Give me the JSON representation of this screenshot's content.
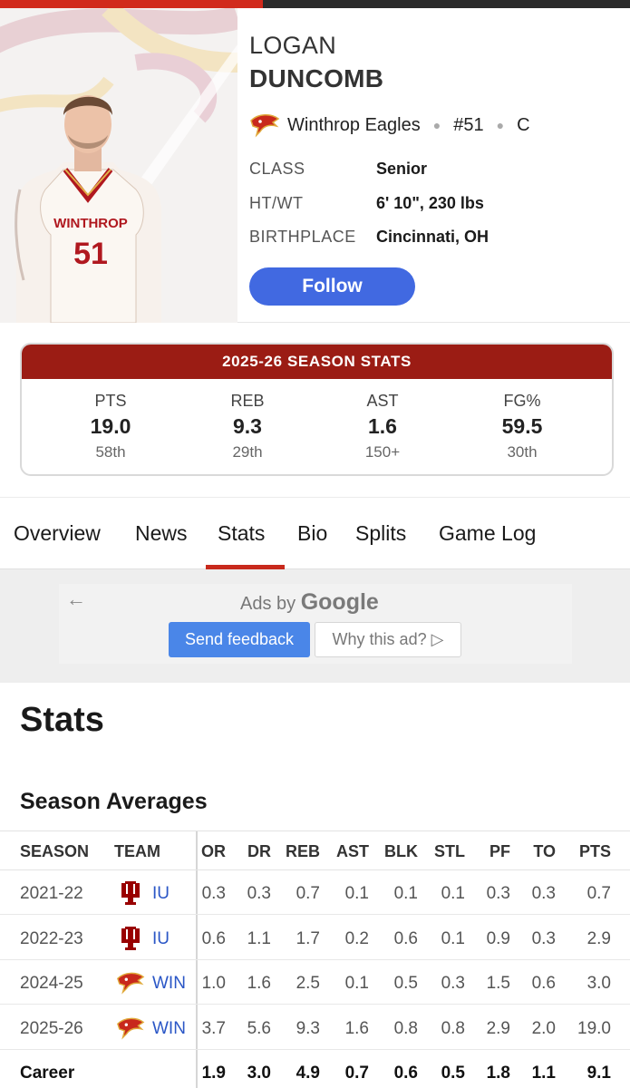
{
  "player": {
    "first_name": "LOGAN",
    "last_name": "DUNCOMB",
    "team": "Winthrop Eagles",
    "number": "#51",
    "position": "C",
    "jersey_text": "WINTHROP",
    "jersey_number": "51"
  },
  "bio": [
    {
      "label": "CLASS",
      "value": "Senior"
    },
    {
      "label": "HT/WT",
      "value": "6' 10\", 230 lbs"
    },
    {
      "label": "BIRTHPLACE",
      "value": "Cincinnati, OH"
    }
  ],
  "follow_label": "Follow",
  "season_card": {
    "title": "2025-26 SEASON STATS",
    "stats": [
      {
        "label": "PTS",
        "value": "19.0",
        "rank": "58th"
      },
      {
        "label": "REB",
        "value": "9.3",
        "rank": "29th"
      },
      {
        "label": "AST",
        "value": "1.6",
        "rank": "150+"
      },
      {
        "label": "FG%",
        "value": "59.5",
        "rank": "30th"
      }
    ]
  },
  "tabs": [
    "Overview",
    "News",
    "Stats",
    "Bio",
    "Splits",
    "Game Log"
  ],
  "active_tab": "Stats",
  "ad": {
    "ads_by": "Ads by",
    "google": "Google",
    "send_feedback": "Send feedback",
    "why_this_ad": "Why this ad? ▷"
  },
  "stats_section": {
    "title": "Stats",
    "subtitle": "Season Averages",
    "columns": [
      "SEASON",
      "TEAM",
      "OR",
      "DR",
      "REB",
      "AST",
      "BLK",
      "STL",
      "PF",
      "TO",
      "PTS"
    ],
    "rows": [
      {
        "season": "2021-22",
        "team": "IU",
        "logo": "indiana",
        "stats": [
          "0.3",
          "0.3",
          "0.7",
          "0.1",
          "0.1",
          "0.1",
          "0.3",
          "0.3",
          "0.7"
        ]
      },
      {
        "season": "2022-23",
        "team": "IU",
        "logo": "indiana",
        "stats": [
          "0.6",
          "1.1",
          "1.7",
          "0.2",
          "0.6",
          "0.1",
          "0.9",
          "0.3",
          "2.9"
        ]
      },
      {
        "season": "2024-25",
        "team": "WIN",
        "logo": "winthrop",
        "stats": [
          "1.0",
          "1.6",
          "2.5",
          "0.1",
          "0.5",
          "0.3",
          "1.5",
          "0.6",
          "3.0"
        ]
      },
      {
        "season": "2025-26",
        "team": "WIN",
        "logo": "winthrop",
        "stats": [
          "3.7",
          "5.6",
          "9.3",
          "1.6",
          "0.8",
          "0.8",
          "2.9",
          "2.0",
          "19.0"
        ]
      }
    ],
    "career": {
      "label": "Career",
      "stats": [
        "1.9",
        "3.0",
        "4.9",
        "0.7",
        "0.6",
        "0.5",
        "1.8",
        "1.1",
        "9.1"
      ]
    }
  },
  "colors": {
    "accent_red": "#c8291c",
    "card_header": "#9b1c14",
    "follow_blue": "#4169e1",
    "team_link": "#2a56c6"
  }
}
